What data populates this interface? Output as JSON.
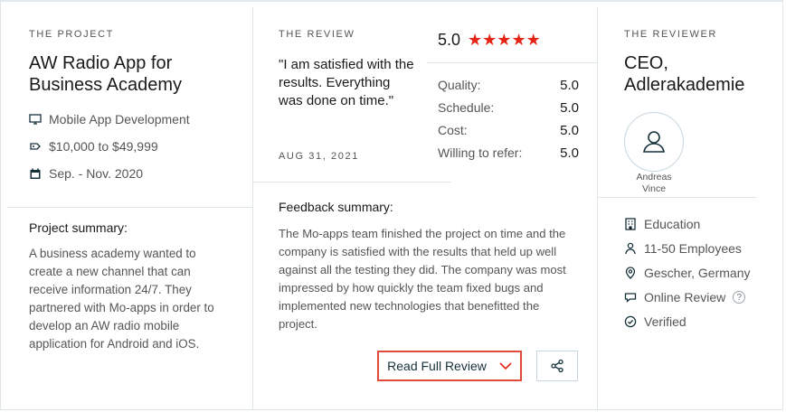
{
  "project": {
    "kicker": "THE PROJECT",
    "title": "AW Radio App for Business Academy",
    "service": "Mobile App Development",
    "budget": "$10,000 to $49,999",
    "dates": "Sep. - Nov. 2020",
    "summary_title": "Project summary:",
    "summary_text": "A business academy wanted to create a new channel that can receive information 24/7. They partnered with Mo-apps in order to develop an AW radio mobile application for Android and iOS."
  },
  "review": {
    "kicker": "THE REVIEW",
    "quote": "\"I am satisfied with the results. Everything was done on time.\"",
    "date": "AUG 31, 2021",
    "overall": "5.0",
    "stars": 5,
    "metrics": [
      {
        "label": "Quality:",
        "value": "5.0"
      },
      {
        "label": "Schedule:",
        "value": "5.0"
      },
      {
        "label": "Cost:",
        "value": "5.0"
      },
      {
        "label": "Willing to refer:",
        "value": "5.0"
      }
    ],
    "feedback_title": "Feedback summary:",
    "feedback_text": "The Mo-apps team finished the project on time and the company is satisfied with the results that held up well against all the testing they did. The company was most impressed by how quickly the team fixed bugs and implemented new technologies that benefitted the project.",
    "read_full_label": "Read Full Review"
  },
  "reviewer": {
    "kicker": "THE REVIEWER",
    "title": "CEO, Adlerakademie",
    "name": "Andreas Vince",
    "industry": "Education",
    "employees": "11-50 Employees",
    "location": "Gescher, Germany",
    "review_type": "Online Review",
    "verification": "Verified"
  },
  "colors": {
    "accent": "#e62415",
    "border": "#dfe6ea",
    "icon": "#17313b"
  },
  "icons": [
    "monitor-icon",
    "tag-icon",
    "calendar-icon",
    "building-icon",
    "person-icon",
    "location-pin-icon",
    "chat-icon",
    "help-icon",
    "check-circle-icon",
    "user-avatar-icon",
    "chevron-down-icon",
    "share-icon",
    "star-icon"
  ]
}
